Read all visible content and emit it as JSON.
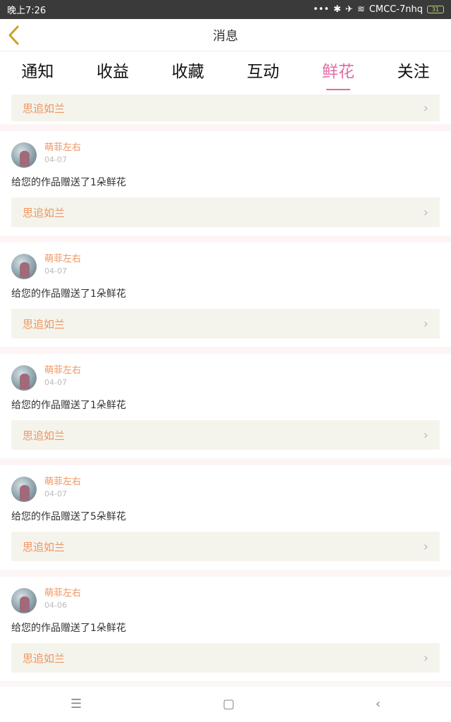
{
  "status_bar": {
    "time": "晚上7:26",
    "network": "CMCC-7nhq",
    "battery": "31"
  },
  "nav": {
    "title": "消息"
  },
  "tabs": [
    {
      "label": "通知"
    },
    {
      "label": "收益"
    },
    {
      "label": "收藏"
    },
    {
      "label": "互动"
    },
    {
      "label": "鲜花",
      "active": true
    },
    {
      "label": "关注"
    }
  ],
  "partial_item": {
    "link": "思追如兰"
  },
  "items": [
    {
      "username": "萌菲左右",
      "date": "04-07",
      "message": "给您的作品赠送了1朵鲜花",
      "link": "思追如兰"
    },
    {
      "username": "萌菲左右",
      "date": "04-07",
      "message": "给您的作品赠送了1朵鲜花",
      "link": "思追如兰"
    },
    {
      "username": "萌菲左右",
      "date": "04-07",
      "message": "给您的作品赠送了1朵鲜花",
      "link": "思追如兰"
    },
    {
      "username": "萌菲左右",
      "date": "04-07",
      "message": "给您的作品赠送了5朵鲜花",
      "link": "思追如兰"
    },
    {
      "username": "萌菲左右",
      "date": "04-06",
      "message": "给您的作品赠送了1朵鲜花",
      "link": "思追如兰"
    }
  ],
  "icons": {
    "back": "chevron-left-icon",
    "menu": "menu-icon",
    "home": "home-square-icon",
    "nav_back": "back-icon"
  },
  "colors": {
    "accent": "#e26ba3",
    "link": "#ee9560",
    "link_bg": "#f5f4ec",
    "divider": "#fdf5f5",
    "status_bar": "#3a3a3a"
  }
}
